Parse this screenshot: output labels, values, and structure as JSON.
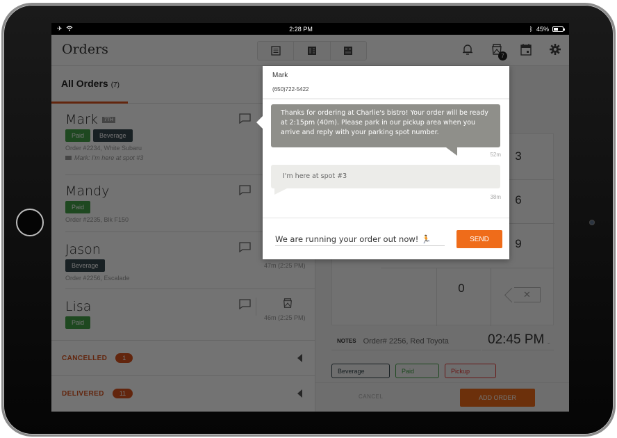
{
  "statusbar": {
    "time": "2:28 PM",
    "battery": "45%"
  },
  "header": {
    "title": "Orders",
    "view_buttons": [
      "list-view",
      "split-view",
      "grid-view"
    ],
    "icons": [
      "bell-icon",
      "pickup-bag-icon",
      "calendar-icon",
      "gear-icon"
    ],
    "pickup_badge": "7"
  },
  "list": {
    "tab_label": "All Orders",
    "tab_count": "(7)",
    "orders": [
      {
        "name": "Mark",
        "seq": "7TH",
        "tags": [
          "Paid",
          "Beverage"
        ],
        "meta": "Order #2234, White Subaru",
        "message": "Mark: I'm here at spot #3"
      },
      {
        "name": "Mandy",
        "tags": [
          "Paid"
        ],
        "meta": "Order #2235, Blk F150"
      },
      {
        "name": "Jason",
        "tags": [
          "Beverage"
        ],
        "meta": "Order #2256, Escalade",
        "elapsed": "47m",
        "time": "(2:25 PM)"
      },
      {
        "name": "Lisa",
        "tags": [
          "Paid"
        ],
        "elapsed": "46m",
        "time": "(2:25 PM)"
      }
    ],
    "sections": [
      {
        "label": "CANCELLED",
        "count": "1"
      },
      {
        "label": "DELIVERED",
        "count": "11"
      }
    ]
  },
  "form": {
    "keys": [
      "3",
      "6",
      "9",
      "0"
    ],
    "notes_label": "NOTES",
    "notes_value": "Order# 2256, Red Toyota",
    "time_value": "02:45 PM",
    "chips": [
      "Beverage",
      "Paid",
      "Pickup"
    ],
    "cancel_label": "CANCEL",
    "add_label": "ADD ORDER"
  },
  "popover": {
    "name": "Mark",
    "phone": "(650)722-5422",
    "messages": [
      {
        "direction": "out",
        "text": "Thanks for ordering at Charlie's bistro! Your order will be ready at 2:15pm (40m). Please park in our pickup area when you arrive and reply with your parking spot number.",
        "age": "52m"
      },
      {
        "direction": "in",
        "text": "I'm here at spot #3",
        "age": "38m"
      }
    ],
    "compose_value": "We are running your order out now! 🏃",
    "send_label": "SEND"
  },
  "colors": {
    "accent": "#ef6c1a",
    "paid": "#43a047",
    "beverage": "#37474f",
    "pickup": "#e53935"
  }
}
